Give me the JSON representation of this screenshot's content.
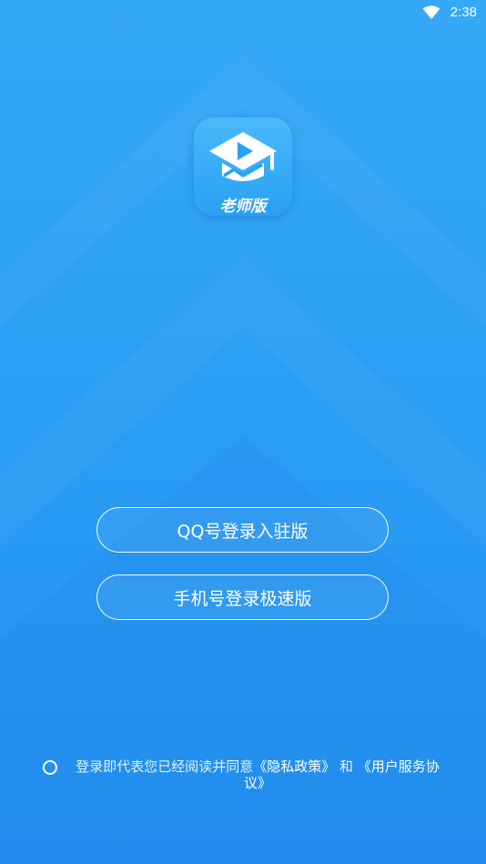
{
  "status_bar": {
    "time": "2:38",
    "wifi_icon": "wifi-icon"
  },
  "logo": {
    "icon": "graduation-cap-play-icon",
    "caption": "老师版"
  },
  "buttons": {
    "qq_login": "QQ号登录入驻版",
    "phone_login": "手机号登录极速版"
  },
  "agreement": {
    "prefix": "登录即代表您已经阅读并同意",
    "privacy_link": "《隐私政策》",
    "conjunction": "和",
    "terms_link": "《用户服务协议》"
  },
  "colors": {
    "background_top": "#36a9f6",
    "background_bottom": "#2390f1",
    "text": "#ffffff"
  }
}
